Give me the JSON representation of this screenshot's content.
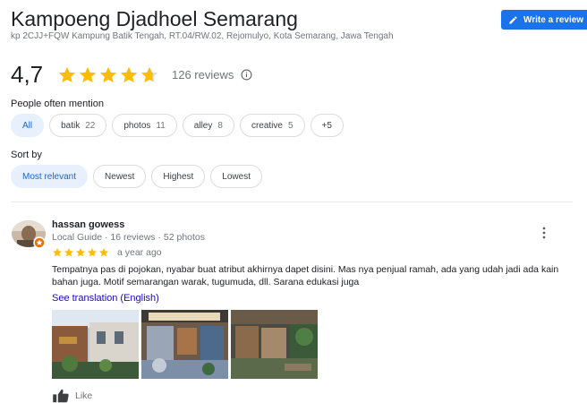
{
  "place": {
    "title": "Kampoeng Djadhoel Semarang",
    "address": "kp 2CJJ+FQW Kampung Batik Tengah, RT.04/RW.02, Rejomulyo, Kota Semarang, Jawa Tengah"
  },
  "write_review": {
    "label": "Write a review",
    "icon": "pencil-icon"
  },
  "rating": {
    "value": "4,7",
    "stars": 4.7,
    "reviews_label": "126 reviews",
    "info_icon": "info-icon"
  },
  "mentions": {
    "label": "People often mention",
    "chips": [
      {
        "label": "All",
        "count": "",
        "active": true
      },
      {
        "label": "batik",
        "count": "22"
      },
      {
        "label": "photos",
        "count": "11"
      },
      {
        "label": "alley",
        "count": "8"
      },
      {
        "label": "creative",
        "count": "5"
      },
      {
        "label": "+5",
        "count": ""
      }
    ]
  },
  "sort": {
    "label": "Sort by",
    "options": [
      {
        "label": "Most relevant",
        "active": true
      },
      {
        "label": "Newest"
      },
      {
        "label": "Highest"
      },
      {
        "label": "Lowest"
      }
    ]
  },
  "review": {
    "author": "hassan gowess",
    "meta": "Local Guide · 16 reviews · 52 photos",
    "stars": 5,
    "date": "a year ago",
    "text": "Tempatnya pas di pojokan, nyabar buat atribut akhirnya dapet disini. Mas nya penjual ramah, ada yang udah jadi ada kain bahan juga. Motif semarangan warak, tugumuda, dll. Sarana edukasi juga",
    "translate_label": "See translation (English)",
    "like_label": "Like",
    "more_icon": "more-vert-icon",
    "like_icon": "thumbs-up-icon"
  },
  "colors": {
    "star": "#fbbc04",
    "accent": "#1a73e8",
    "chip_active_bg": "#e8f0fe",
    "link": "#1a0dab"
  }
}
